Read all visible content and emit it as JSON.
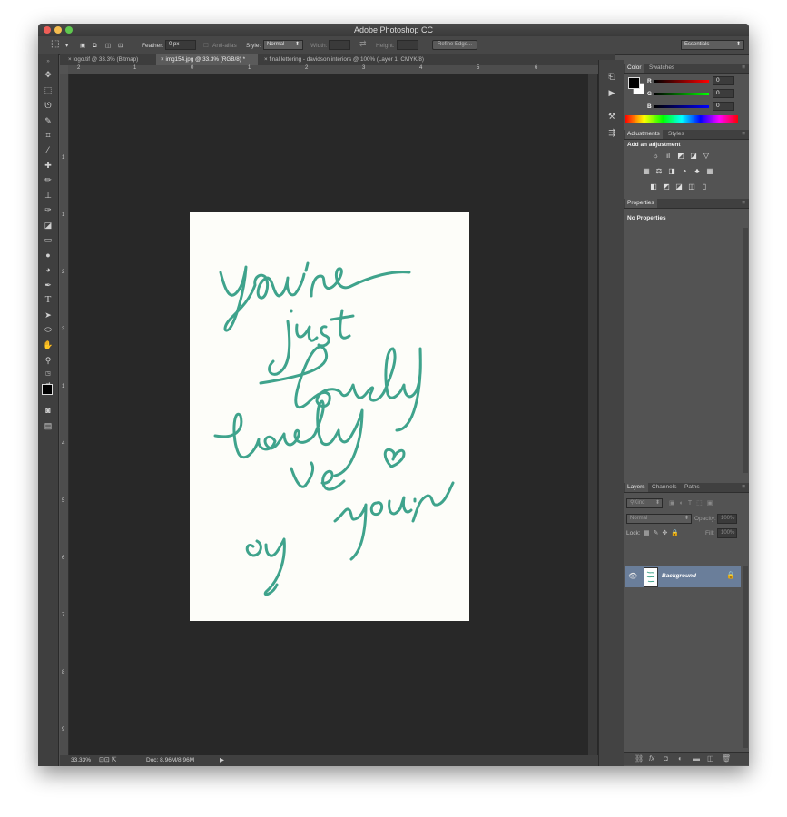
{
  "window": {
    "title": "Adobe Photoshop CC"
  },
  "options_bar": {
    "feather_label": "Feather:",
    "feather_value": "0 px",
    "antialias_label": "Anti-alias",
    "style_label": "Style:",
    "style_value": "Normal",
    "width_label": "Width:",
    "height_label": "Height:",
    "refine_edge": "Refine Edge...",
    "workspace": "Essentials"
  },
  "document_tabs": [
    {
      "label": "logo.tif @ 33.3% (Bitmap)"
    },
    {
      "label": "img154.jpg @ 33.3% (RGB/8) *"
    },
    {
      "label": "final lettering - davidson interiors @ 100% (Layer 1, CMYK/8)"
    }
  ],
  "rulers": {
    "h": [
      "2",
      "1",
      "0",
      "1",
      "2",
      "3",
      "4",
      "5",
      "6"
    ],
    "v": [
      "1",
      "1",
      "2",
      "3",
      "1",
      "4",
      "5",
      "6",
      "7",
      "8",
      "9"
    ]
  },
  "status_bar": {
    "zoom": "33.33%",
    "doc": "Doc: 8.96M/8.96M"
  },
  "color_panel": {
    "tabs": [
      "Color",
      "Swatches"
    ],
    "r_label": "R",
    "r_value": "0",
    "g_label": "G",
    "g_value": "0",
    "b_label": "B",
    "b_value": "0"
  },
  "adjustments_panel": {
    "tabs": [
      "Adjustments",
      "Styles"
    ],
    "heading": "Add an adjustment"
  },
  "properties_panel": {
    "tab": "Properties",
    "text": "No Properties"
  },
  "layers_panel": {
    "tabs": [
      "Layers",
      "Channels",
      "Paths"
    ],
    "kind_label": "Kind",
    "blend_mode": "Normal",
    "opacity_label": "Opacity:",
    "opacity_value": "100%",
    "lock_label": "Lock:",
    "fill_label": "Fill:",
    "fill_value": "100%",
    "layers": [
      {
        "name": "Background"
      }
    ]
  },
  "artwork": {
    "lines": [
      "you're",
      "just",
      "lovely",
      "lovely",
      "ve",
      "your",
      "oy"
    ],
    "ink_color": "#3fa38c"
  },
  "colors": {
    "canvas_bg": "#282828",
    "accent_selected_layer": "#6a7e9a"
  }
}
